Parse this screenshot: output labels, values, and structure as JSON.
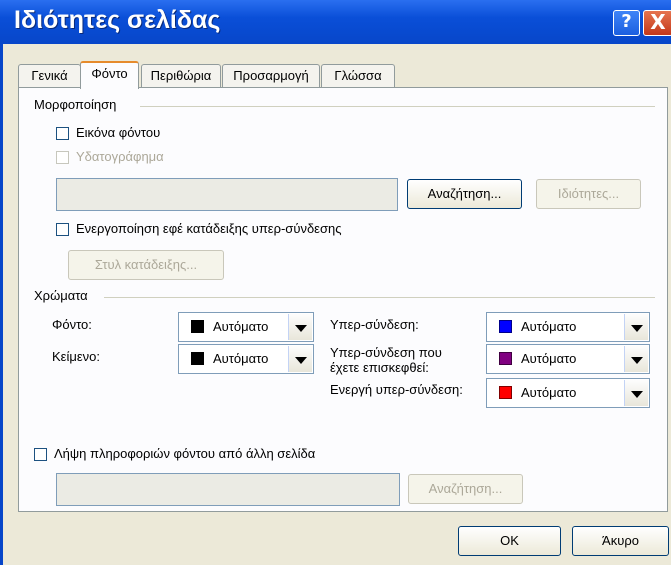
{
  "window": {
    "title": "Ιδιότητες σελίδας",
    "help_glyph": "?",
    "close_glyph": "X"
  },
  "tabs": [
    "Γενικά",
    "Φόντο",
    "Περιθώρια",
    "Προσαρμογή",
    "Γλώσσα"
  ],
  "active_tab": "Φόντο",
  "formatting": {
    "group_label": "Μορφοποίηση",
    "background_picture_label": "Εικόνα φόντου",
    "background_picture_checked": false,
    "watermark_label": "Υδατογράφημα",
    "watermark_checked": false,
    "picture_path": "",
    "browse_label": "Αναζήτηση...",
    "properties_label": "Ιδιότητες...",
    "rollover_label": "Ενεργοποίηση εφέ κατάδειξης υπερ-σύνδεσης",
    "rollover_checked": false,
    "rollover_style_label": "Στυλ κατάδειξης..."
  },
  "colors": {
    "group_label": "Χρώματα",
    "background": {
      "label": "Φόντο:",
      "value": "Αυτόματο",
      "swatch": "#000000"
    },
    "text": {
      "label": "Κείμενο:",
      "value": "Αυτόματο",
      "swatch": "#000000"
    },
    "hyperlink": {
      "label": "Υπερ-σύνδεση:",
      "value": "Αυτόματο",
      "swatch": "#0000ff"
    },
    "visited": {
      "label_line1": "Υπερ-σύνδεση που",
      "label_line2": "έχετε επισκεφθεί:",
      "value": "Αυτόματο",
      "swatch": "#800080"
    },
    "active": {
      "label": "Ενεργή υπερ-σύνδεση:",
      "value": "Αυτόματο",
      "swatch": "#ff0000"
    }
  },
  "other_page": {
    "label": "Λήψη πληροφοριών φόντου από άλλη σελίδα",
    "checked": false,
    "path": "",
    "browse_label": "Αναζήτηση..."
  },
  "buttons": {
    "ok": "OK",
    "cancel": "Άκυρο"
  }
}
